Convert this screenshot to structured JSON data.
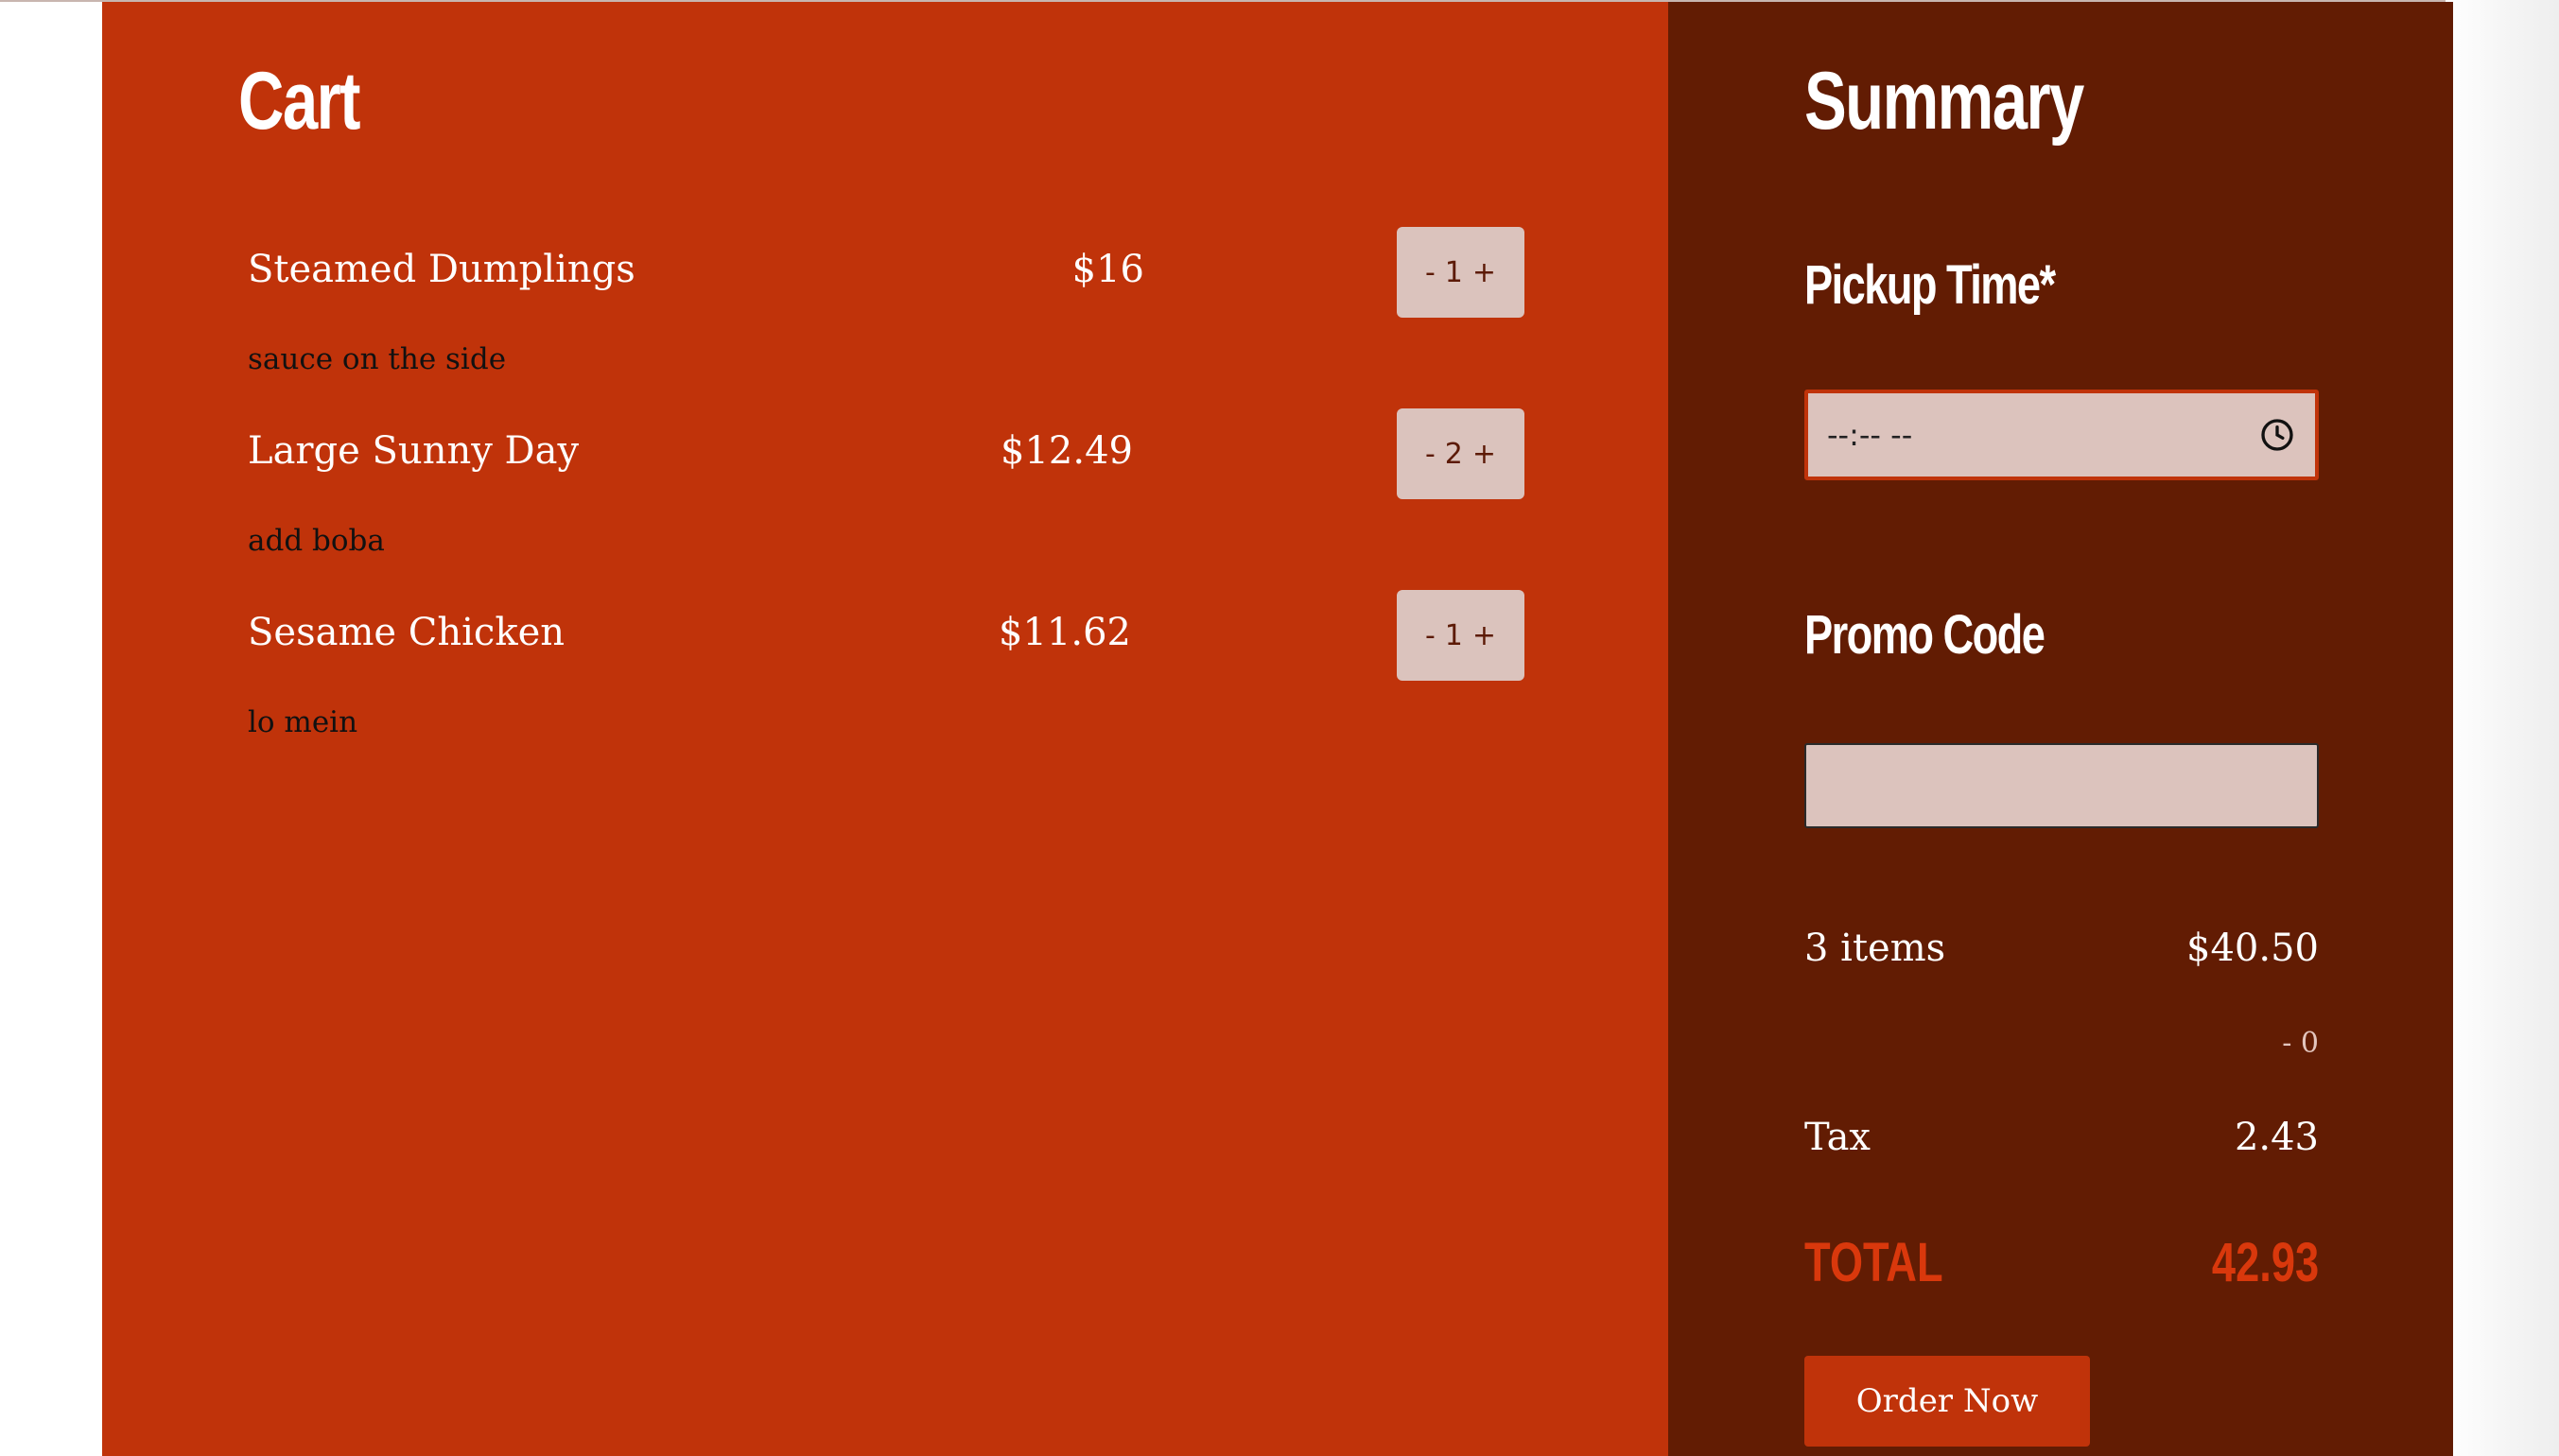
{
  "cart": {
    "title": "Cart",
    "items": [
      {
        "name": "Steamed Dumplings",
        "price": "$16",
        "note": "sauce on the side",
        "minus": "-",
        "qty": "1",
        "plus": "+"
      },
      {
        "name": "Large Sunny Day",
        "price": "$12.49",
        "note": "add boba",
        "minus": "-",
        "qty": "2",
        "plus": "+"
      },
      {
        "name": "Sesame Chicken",
        "price": "$11.62",
        "note": "lo mein",
        "minus": "-",
        "qty": "1",
        "plus": "+"
      }
    ]
  },
  "summary": {
    "title": "Summary",
    "pickup_label": "Pickup Time*",
    "pickup_placeholder": "--:-- --",
    "promo_label": "Promo Code",
    "promo_value": "",
    "items_count": "3 items",
    "subtotal": "$40.50",
    "discount": "- 0",
    "tax_label": "Tax",
    "tax_value": "2.43",
    "total_label": "TOTAL",
    "total_value": "42.93",
    "order_button": "Order Now"
  },
  "colors": {
    "cart_bg": "#c0330a",
    "summary_bg": "#621c03",
    "input_bg": "#dcc3bd",
    "total_text": "#d9380c"
  },
  "icons": {
    "pickup_time": "clock-icon"
  }
}
